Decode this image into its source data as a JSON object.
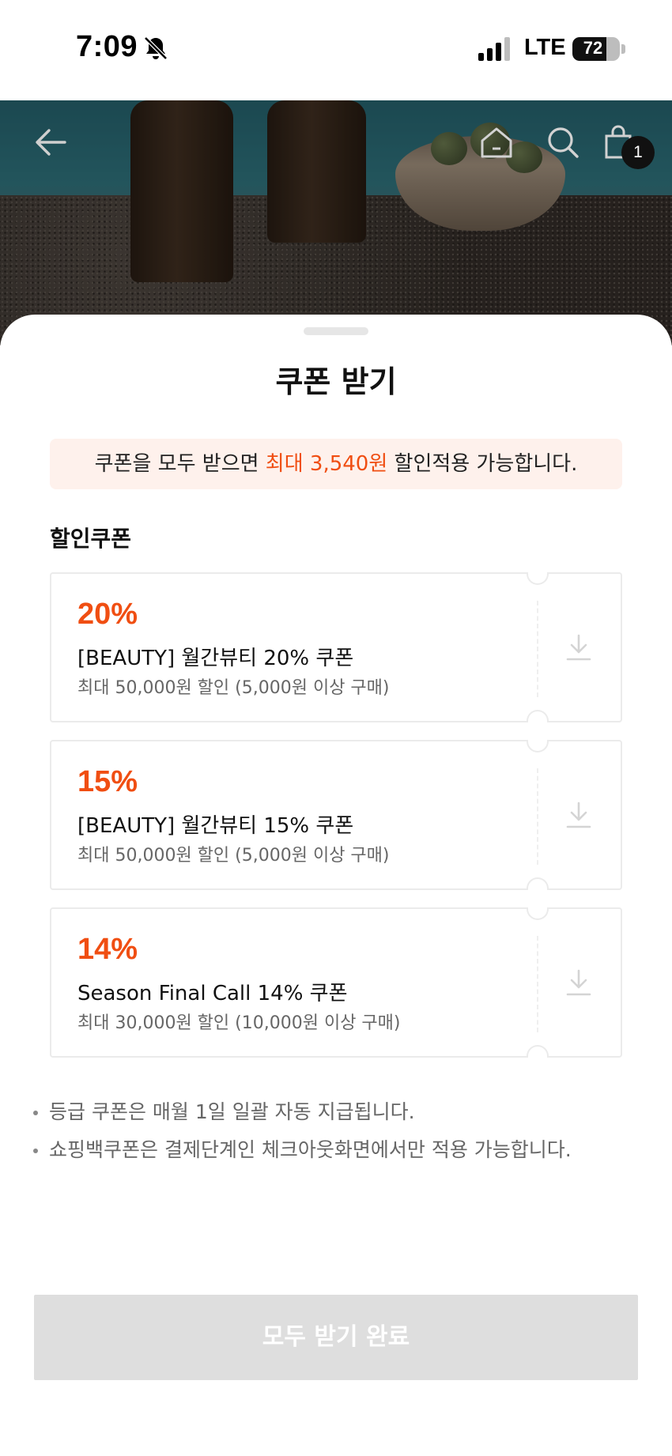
{
  "status_bar": {
    "time": "7:09",
    "network": "LTE",
    "battery": "72",
    "battery_level": 0.72,
    "icons": [
      "bell-slash-icon",
      "signal-icon",
      "battery-icon"
    ]
  },
  "header": {
    "icons": [
      "back-arrow-icon",
      "home-icon",
      "search-icon",
      "shopping-bag-icon"
    ],
    "cart_count": "1"
  },
  "sheet": {
    "title": "쿠폰 받기",
    "banner": {
      "prefix": "쿠폰을 모두 받으면 ",
      "highlight": "최대 3,540원",
      "suffix": " 할인적용 가능합니다."
    },
    "section_title": "할인쿠폰",
    "coupons": [
      {
        "percent": "20%",
        "name": "[BEAUTY] 월간뷰티 20% 쿠폰",
        "condition": "최대 50,000원 할인 (5,000원 이상 구매)"
      },
      {
        "percent": "15%",
        "name": "[BEAUTY] 월간뷰티 15% 쿠폰",
        "condition": "최대 50,000원 할인 (5,000원 이상 구매)"
      },
      {
        "percent": "14%",
        "name": "Season Final Call 14% 쿠폰",
        "condition": "최대 30,000원 할인 (10,000원 이상 구매)"
      }
    ],
    "notes": [
      "등급 쿠폰은 매월 1일 일괄 자동 지급됩니다.",
      "쇼핑백쿠폰은 결제단계인 체크아웃화면에서만 적용 가능합니다."
    ],
    "cta_label": "모두 받기 완료"
  },
  "colors": {
    "accent": "#f04e12",
    "banner_bg": "#fef1ec",
    "cta_disabled": "#dedede"
  }
}
